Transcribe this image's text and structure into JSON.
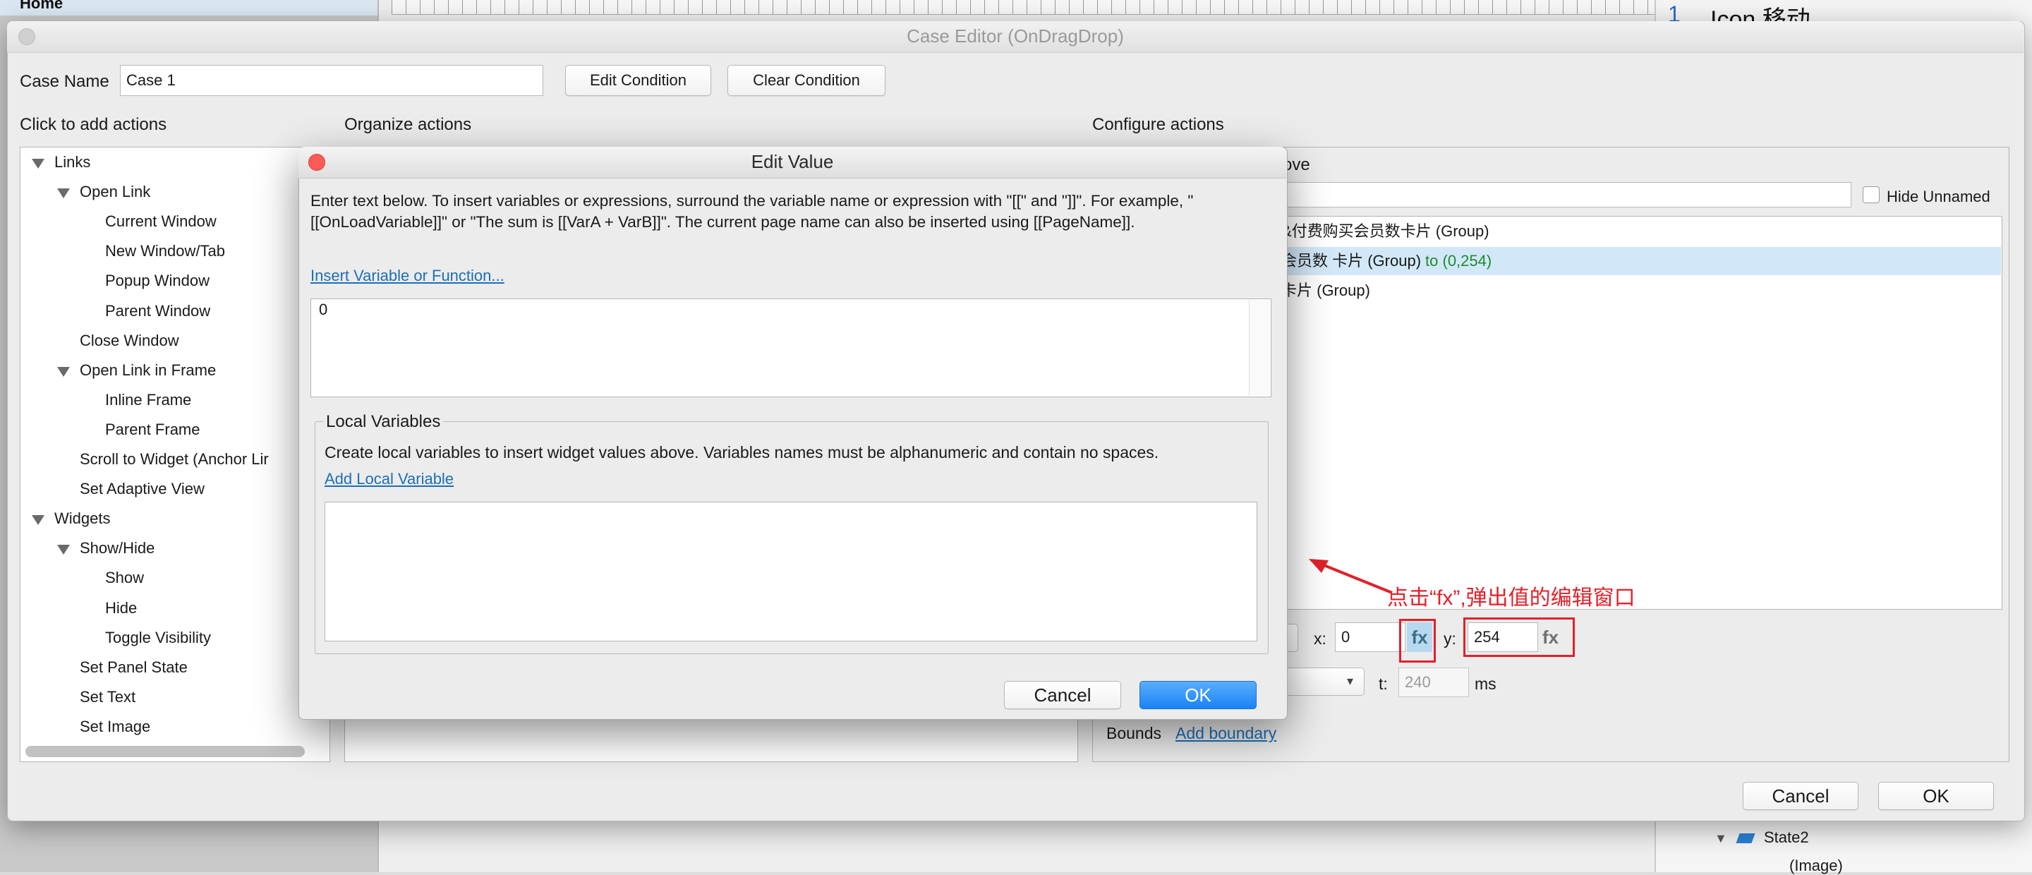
{
  "background": {
    "left_tree_item": "Home",
    "right_number": "1",
    "right_title": "Icon  移动",
    "state2": "State2",
    "image_item": "(Image)"
  },
  "case_editor": {
    "title": "Case Editor (OnDragDrop)",
    "case_name_label": "Case Name",
    "case_name_value": "Case 1",
    "edit_condition": "Edit Condition",
    "clear_condition": "Clear Condition",
    "add_actions_header": "Click to add actions",
    "organize_header": "Organize actions",
    "configure_header": "Configure actions",
    "tree": [
      {
        "label": "Links",
        "level": 0,
        "expanded": true
      },
      {
        "label": "Open Link",
        "level": 1,
        "expanded": true
      },
      {
        "label": "Current Window",
        "level": 2
      },
      {
        "label": "New Window/Tab",
        "level": 2
      },
      {
        "label": "Popup Window",
        "level": 2
      },
      {
        "label": "Parent Window",
        "level": 2
      },
      {
        "label": "Close Window",
        "level": 1
      },
      {
        "label": "Open Link in Frame",
        "level": 1,
        "expanded": true
      },
      {
        "label": "Inline Frame",
        "level": 2
      },
      {
        "label": "Parent Frame",
        "level": 2
      },
      {
        "label": "Scroll to Widget (Anchor Lir",
        "level": 1
      },
      {
        "label": "Set Adaptive View",
        "level": 1
      },
      {
        "label": "Widgets",
        "level": 0,
        "expanded": true
      },
      {
        "label": "Show/Hide",
        "level": 1,
        "expanded": true
      },
      {
        "label": "Show",
        "level": 2
      },
      {
        "label": "Hide",
        "level": 2
      },
      {
        "label": "Toggle Visibility",
        "level": 2
      },
      {
        "label": "Set Panel State",
        "level": 1
      },
      {
        "label": "Set Text",
        "level": 1
      },
      {
        "label": "Set Image",
        "level": 1
      }
    ],
    "configure": {
      "move_label_partial": "ove",
      "hide_unnamed": "Hide Unnamed",
      "widgets": [
        {
          "text": "&付费购买会员数卡片 (Group)",
          "extra": "",
          "selected": false
        },
        {
          "text": "会员数 卡片 (Group)",
          "extra": "to (0,254)",
          "selected": true
        },
        {
          "text": "卡片 (Group)",
          "extra": "",
          "selected": false
        }
      ],
      "x_label": "x:",
      "x_value": "0",
      "y_label": "y:",
      "y_value": "254",
      "fx": "fx",
      "t_label": "t:",
      "t_value": "240",
      "ms": "ms",
      "bounds_label": "Bounds",
      "add_boundary": "Add boundary"
    },
    "cancel": "Cancel",
    "ok": "OK"
  },
  "edit_value": {
    "title": "Edit Value",
    "description": "Enter text below. To insert variables or expressions, surround the variable name or expression with \"[[\" and \"]]\". For example, \"[[OnLoadVariable]]\" or \"The sum is [[VarA + VarB]]\". The current page name can also be inserted using [[PageName]].",
    "insert_link": "Insert Variable or Function...",
    "value": "0",
    "local_variables_title": "Local Variables",
    "local_variables_desc": "Create local variables to insert widget values above. Variables names must be alphanumeric and contain no spaces.",
    "add_local_variable": "Add Local Variable",
    "cancel": "Cancel",
    "ok": "OK"
  },
  "annotation": {
    "text": "点击“fx”,弹出值的编辑窗口",
    "color": "#e3202a"
  },
  "colors": {
    "accent_blue": "#1a82f5",
    "selection": "#d2e8f8",
    "link": "#1c6fb8",
    "close_red": "#fc5b57"
  }
}
